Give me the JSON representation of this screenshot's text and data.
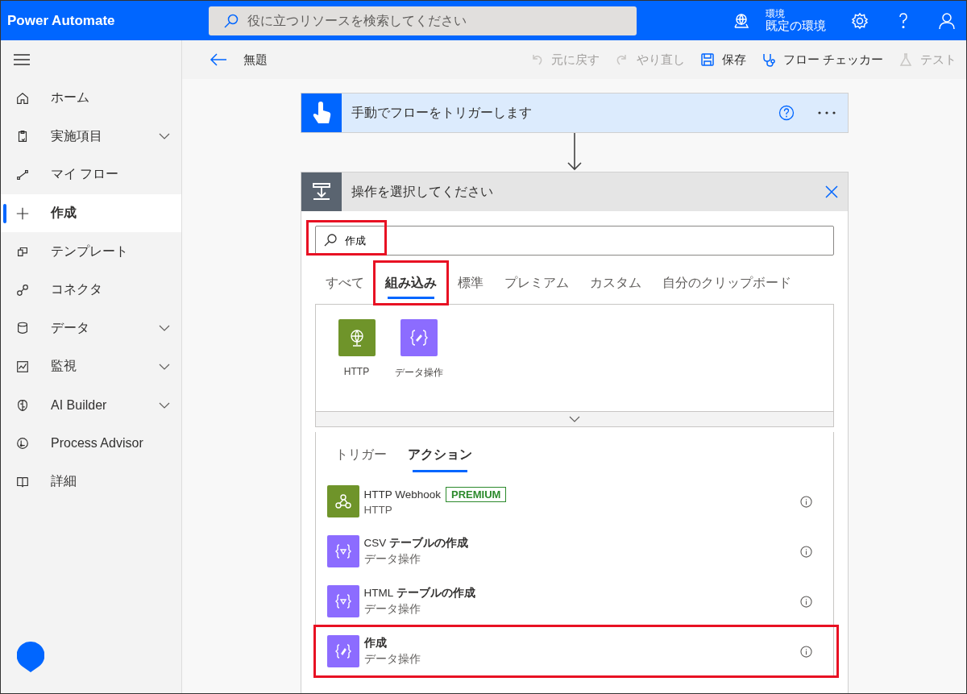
{
  "header": {
    "app_title": "Power Automate",
    "search_placeholder": "役に立つリソースを検索してください",
    "environment_label": "環境",
    "environment_name": "既定の環境"
  },
  "sidebar": {
    "items": [
      {
        "label": "ホーム",
        "selected": false,
        "expandable": false
      },
      {
        "label": "実施項目",
        "selected": false,
        "expandable": true
      },
      {
        "label": "マイ フロー",
        "selected": false,
        "expandable": false
      },
      {
        "label": "作成",
        "selected": true,
        "expandable": false
      },
      {
        "label": "テンプレート",
        "selected": false,
        "expandable": false
      },
      {
        "label": "コネクタ",
        "selected": false,
        "expandable": false
      },
      {
        "label": "データ",
        "selected": false,
        "expandable": true
      },
      {
        "label": "監視",
        "selected": false,
        "expandable": true
      },
      {
        "label": "AI Builder",
        "selected": false,
        "expandable": true
      },
      {
        "label": "Process Advisor",
        "selected": false,
        "expandable": false
      },
      {
        "label": "詳細",
        "selected": false,
        "expandable": false
      }
    ]
  },
  "toolbar": {
    "title": "無題",
    "actions": [
      {
        "label": "元に戻す",
        "disabled": true
      },
      {
        "label": "やり直し",
        "disabled": true
      },
      {
        "label": "保存",
        "disabled": false
      },
      {
        "label": "フロー チェッカー",
        "disabled": false
      },
      {
        "label": "テスト",
        "disabled": true
      }
    ]
  },
  "trigger": {
    "title": "手動でフローをトリガーします"
  },
  "picker": {
    "title": "操作を選択してください",
    "search": {
      "value": "作成",
      "highlighted": true
    },
    "tabs": [
      {
        "label": "すべて",
        "selected": false,
        "highlighted": false
      },
      {
        "label": "組み込み",
        "selected": true,
        "highlighted": true
      },
      {
        "label": "標準",
        "selected": false,
        "highlighted": false
      },
      {
        "label": "プレミアム",
        "selected": false,
        "highlighted": false
      },
      {
        "label": "カスタム",
        "selected": false,
        "highlighted": false
      },
      {
        "label": "自分のクリップボード",
        "selected": false,
        "highlighted": false
      }
    ],
    "connectors": [
      {
        "label": "HTTP",
        "color": "#6f942a",
        "kind": "globe"
      },
      {
        "label": "データ操作",
        "color": "#8c6cff",
        "kind": "braces"
      }
    ],
    "subtabs": [
      {
        "label": "トリガー",
        "selected": false
      },
      {
        "label": "アクション",
        "selected": true
      }
    ],
    "actions": [
      {
        "name": "HTTP Webhook",
        "bold": false,
        "connector": "HTTP",
        "badge": "PREMIUM",
        "color": "#6f942a",
        "kind": "webhook",
        "highlighted": false
      },
      {
        "name": "CSV **テーブルの作成**",
        "bold": false,
        "connector": "データ操作",
        "color": "#8c6cff",
        "kind": "table",
        "highlighted": false
      },
      {
        "name": "HTML **テーブルの作成**",
        "bold": false,
        "connector": "データ操作",
        "color": "#8c6cff",
        "kind": "table",
        "highlighted": false
      },
      {
        "name": "作成",
        "bold": true,
        "connector": "データ操作",
        "color": "#8c6cff",
        "kind": "braces",
        "highlighted": true
      }
    ]
  }
}
